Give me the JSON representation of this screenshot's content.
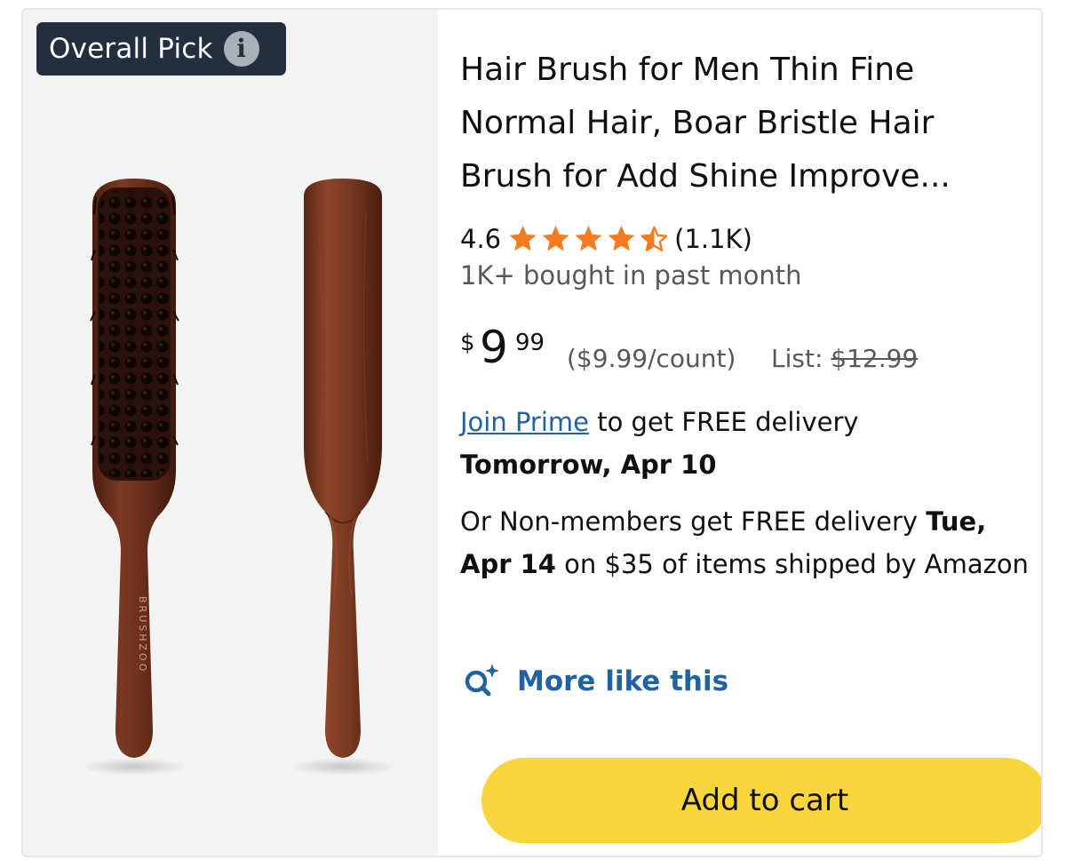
{
  "badge": {
    "label": "Overall Pick",
    "icon": "info-icon"
  },
  "product": {
    "image_alt": "Boar bristle hair brush, front and back views",
    "brand_on_handle": "BRUSHZOO",
    "title": "Hair Brush for Men Thin Fine Normal Hair, Boar Bristle Hair Brush for Add Shine Improve...",
    "rating": "4.6",
    "rating_value": 4.6,
    "rating_max": 5,
    "rating_count": "(1.1K)",
    "bought": "1K+ bought in past month",
    "price": {
      "symbol": "$",
      "whole": "9",
      "fraction": "99",
      "unit_price": "($9.99/count)",
      "list_label": "List:",
      "list_price": "$12.99"
    },
    "delivery": {
      "prime_link": "Join Prime",
      "prime_text": " to get FREE delivery",
      "prime_date": "Tomorrow, Apr 10",
      "nonmember_prefix": "Or Non-members get FREE delivery ",
      "nonmember_date": "Tue, Apr 14",
      "nonmember_suffix": " on $35 of items shipped by Amazon"
    },
    "more_like_this": "More like this",
    "add_to_cart": "Add to cart"
  },
  "colors": {
    "badge_bg": "#232f3e",
    "star": "#f47b20",
    "link": "#2162a1",
    "cart_button": "#f8d53d",
    "image_bg": "#f3f3f3"
  }
}
